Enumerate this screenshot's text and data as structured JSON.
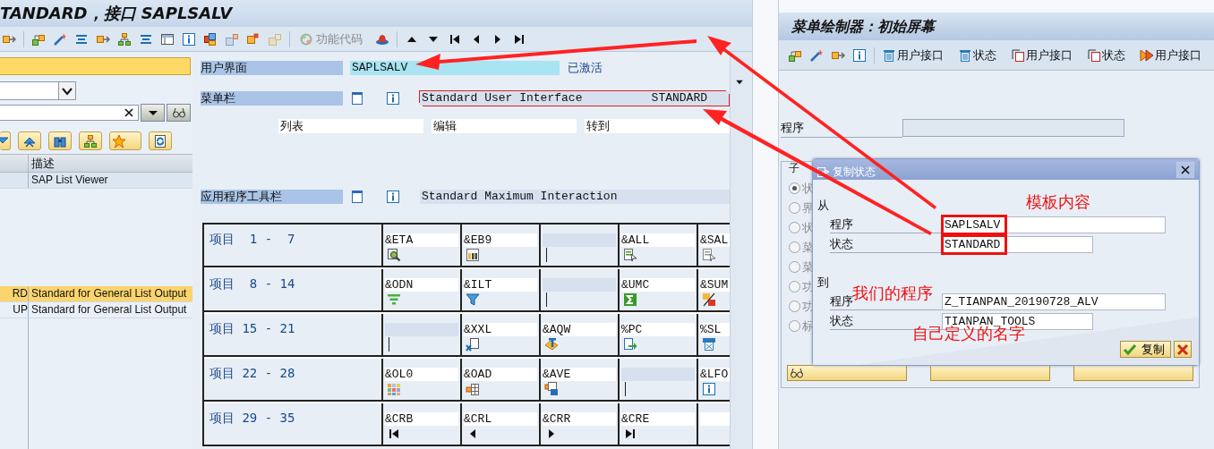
{
  "left_window": {
    "title": "TANDARD，接口 SAPLSALV",
    "toolbar": {
      "function_code": "功能代码",
      "function_code_disabled": true
    }
  },
  "object_list": {
    "column_header": "描述",
    "rows": [
      {
        "description": "SAP List Viewer",
        "selected": false
      },
      {
        "name": "RD",
        "description": "Standard for General List Output",
        "selected": true
      },
      {
        "name": "UP",
        "description": "Standard for General List Output",
        "selected": false
      }
    ]
  },
  "interface": {
    "label": "用户界面",
    "value": "SAPLSALV",
    "status": "已激活"
  },
  "menu_bar": {
    "label": "菜单栏",
    "value": "Standard User Interface",
    "code": "STANDARD",
    "focused": true,
    "menus": [
      "列表",
      "编辑",
      "转到"
    ]
  },
  "application_toolbar": {
    "label": "应用程序工具栏",
    "value": "Standard Maximum Interaction"
  },
  "items": [
    {
      "label": "项目  1 -  7",
      "cells": [
        {
          "kind": "function",
          "code": "&ETA"
        },
        {
          "kind": "function",
          "code": "&EB9"
        },
        {
          "kind": "empty"
        },
        {
          "kind": "function",
          "code": "&ALL"
        },
        {
          "kind": "function",
          "code": "&SAL"
        }
      ]
    },
    {
      "label": "项目  8 - 14",
      "cells": [
        {
          "kind": "function",
          "code": "&ODN"
        },
        {
          "kind": "function",
          "code": "&ILT"
        },
        {
          "kind": "empty"
        },
        {
          "kind": "function",
          "code": "&UMC"
        },
        {
          "kind": "function",
          "code": "&SUM"
        }
      ]
    },
    {
      "label": "项目 15 - 21",
      "cells": [
        {
          "kind": "empty"
        },
        {
          "kind": "function",
          "code": "&XXL"
        },
        {
          "kind": "function",
          "code": "&AQW"
        },
        {
          "kind": "function",
          "code": "%PC"
        },
        {
          "kind": "function",
          "code": "%SL"
        }
      ]
    },
    {
      "label": "项目 22 - 28",
      "cells": [
        {
          "kind": "function",
          "code": "&OL0"
        },
        {
          "kind": "function",
          "code": "&OAD"
        },
        {
          "kind": "function",
          "code": "&AVE"
        },
        {
          "kind": "empty"
        },
        {
          "kind": "function",
          "code": "&LFO"
        }
      ]
    },
    {
      "label": "项目 29 - 35",
      "cells": [
        {
          "kind": "function",
          "code": "&CRB"
        },
        {
          "kind": "function",
          "code": "&CRL"
        },
        {
          "kind": "function",
          "code": "&CRR"
        },
        {
          "kind": "function",
          "code": "&CRE"
        },
        {
          "kind": "blank"
        }
      ]
    }
  ],
  "right_window": {
    "title": "菜单绘制器：初始屏幕",
    "toolbar": [
      "用户接口",
      "状态",
      "用户接口",
      "状态",
      "用户接口"
    ],
    "program_label": "程序",
    "group_title": "子",
    "options": [
      {
        "label": "状",
        "selected": true
      },
      {
        "label": "界",
        "selected": false
      },
      {
        "label": "状",
        "selected": false
      },
      {
        "label": "菜",
        "selected": false
      },
      {
        "label": "菜",
        "selected": false
      },
      {
        "label": "功",
        "selected": false
      },
      {
        "label": "功",
        "selected": false
      },
      {
        "label": "标",
        "selected": false
      }
    ]
  },
  "dialog": {
    "title": "复制状态",
    "from_label": "从",
    "from": [
      {
        "label": "程序",
        "value": "SAPLSALV",
        "highlighted": true
      },
      {
        "label": "状态",
        "value": "STANDARD",
        "highlighted": true
      }
    ],
    "to_label": "到",
    "to": [
      {
        "label": "程序",
        "value": "Z_TIANPAN_20190728_ALV",
        "highlighted": false
      },
      {
        "label": "状态",
        "value": "TIANPAN_TOOLS",
        "highlighted": false
      }
    ],
    "ok": "复制"
  },
  "annotations": [
    "模板内容",
    "我们的程序",
    "自己定义的名字"
  ]
}
